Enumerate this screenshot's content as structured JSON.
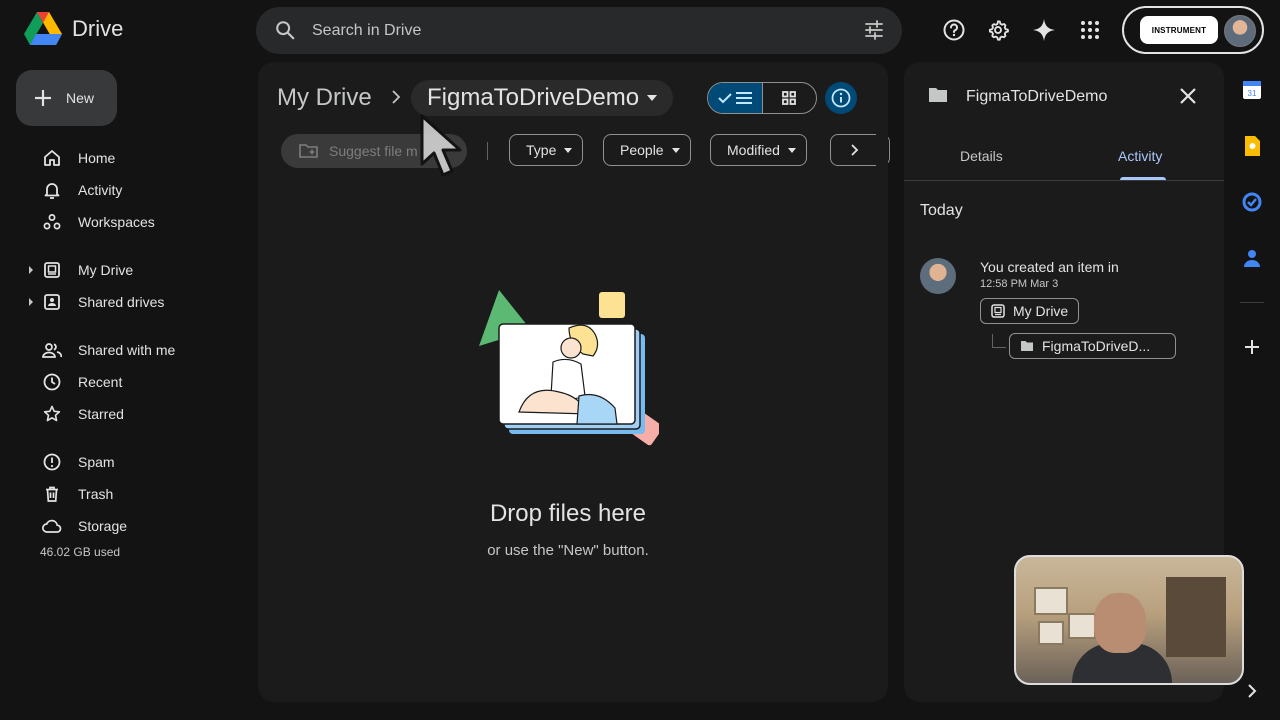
{
  "app": {
    "name": "Drive"
  },
  "search": {
    "placeholder": "Search in Drive"
  },
  "account": {
    "org_label": "INSTRUMENT"
  },
  "sidebar": {
    "new_label": "New",
    "items": [
      {
        "label": "Home",
        "icon": "home-icon"
      },
      {
        "label": "Activity",
        "icon": "bell-icon"
      },
      {
        "label": "Workspaces",
        "icon": "workspaces-icon"
      },
      {
        "label": "My Drive",
        "icon": "my-drive-icon",
        "expandable": true
      },
      {
        "label": "Shared drives",
        "icon": "shared-drives-icon",
        "expandable": true
      },
      {
        "label": "Shared with me",
        "icon": "people-icon"
      },
      {
        "label": "Recent",
        "icon": "clock-icon"
      },
      {
        "label": "Starred",
        "icon": "star-icon"
      },
      {
        "label": "Spam",
        "icon": "spam-icon"
      },
      {
        "label": "Trash",
        "icon": "trash-icon"
      },
      {
        "label": "Storage",
        "icon": "cloud-icon"
      }
    ],
    "storage_used": "46.02 GB used"
  },
  "main": {
    "breadcrumb_root": "My Drive",
    "breadcrumb_current": "FigmaToDriveDemo",
    "suggest_label": "Suggest file m",
    "filters": [
      "Type",
      "People",
      "Modified"
    ],
    "empty_title": "Drop files here",
    "empty_subtitle": "or use the \"New\" button."
  },
  "details": {
    "title": "FigmaToDriveDemo",
    "tabs": [
      "Details",
      "Activity"
    ],
    "active_tab": "Activity",
    "section": "Today",
    "activity_text": "You created an item in",
    "activity_time": "12:58 PM Mar 3",
    "location_parent": "My Drive",
    "location_child": "FigmaToDriveD..."
  },
  "colors": {
    "background": "#131314",
    "surface": "#1b1b1b",
    "accent": "#a8c7fa",
    "toggle_active": "#004a77"
  }
}
